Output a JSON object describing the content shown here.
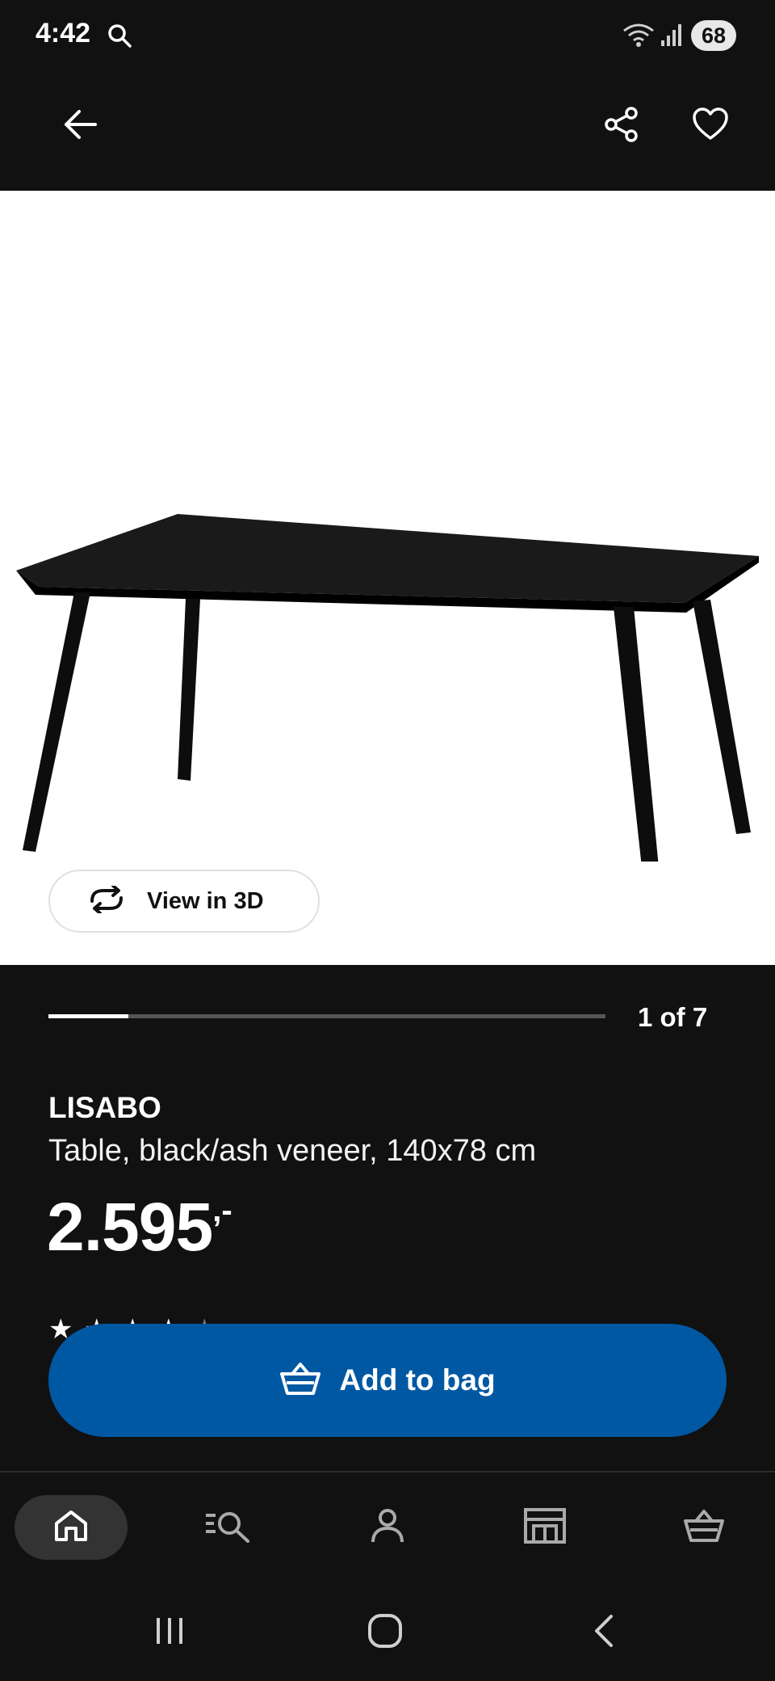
{
  "status_bar": {
    "time": "4:42",
    "battery": "68",
    "icons": [
      "search-icon",
      "wifi-icon",
      "signal-icon"
    ]
  },
  "app_bar": {
    "icons": [
      "arrow-left-icon",
      "share-icon",
      "heart-icon"
    ]
  },
  "gallery": {
    "view_3d_label": "View in 3D",
    "image_position": "1 of 7",
    "progress_fraction": 0.143
  },
  "product": {
    "name": "LISABO",
    "description": "Table, black/ash veneer, 140x78 cm",
    "price": "2.595",
    "price_suffix": ",-"
  },
  "actions": {
    "add_to_bag_label": "Add to bag"
  },
  "bottom_nav": {
    "items": [
      {
        "icon": "home-icon",
        "selected": true
      },
      {
        "icon": "search-list-icon",
        "selected": false
      },
      {
        "icon": "profile-icon",
        "selected": false
      },
      {
        "icon": "store-icon",
        "selected": false
      },
      {
        "icon": "shopping-bag-icon",
        "selected": false
      }
    ]
  },
  "system_nav": {
    "icons": [
      "recent-apps-icon",
      "home-circle-icon",
      "system-back-icon"
    ]
  },
  "colors": {
    "background": "#111111",
    "accent": "#0058a3",
    "image_background": "#ffffff"
  }
}
